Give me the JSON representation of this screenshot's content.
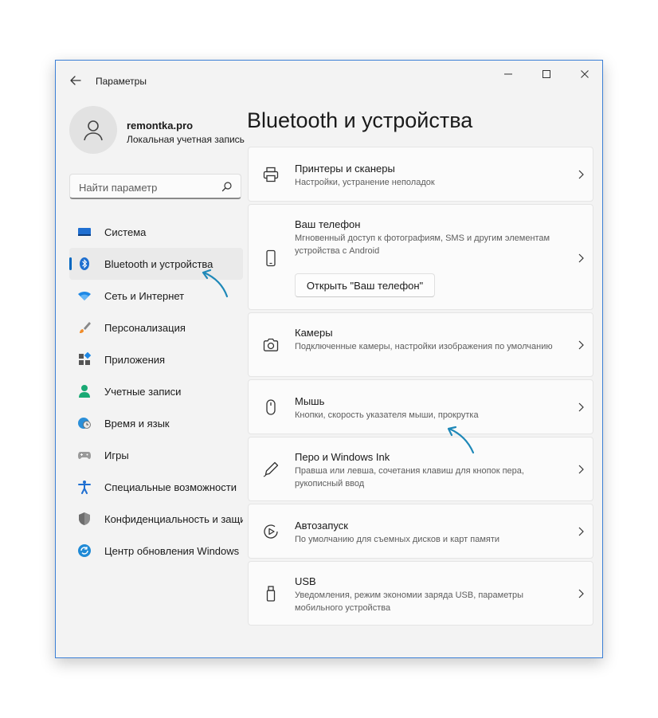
{
  "window": {
    "title": "Параметры"
  },
  "user": {
    "name": "remontka.pro",
    "account_type": "Локальная учетная запись"
  },
  "search": {
    "placeholder": "Найти параметр"
  },
  "sidebar": {
    "items": [
      {
        "label": "Система",
        "icon": "monitor-icon"
      },
      {
        "label": "Bluetooth и устройства",
        "icon": "bluetooth-icon",
        "active": true
      },
      {
        "label": "Сеть и Интернет",
        "icon": "wifi-icon"
      },
      {
        "label": "Персонализация",
        "icon": "brush-icon"
      },
      {
        "label": "Приложения",
        "icon": "apps-icon"
      },
      {
        "label": "Учетные записи",
        "icon": "person-icon"
      },
      {
        "label": "Время и язык",
        "icon": "globe-clock-icon"
      },
      {
        "label": "Игры",
        "icon": "gamepad-icon"
      },
      {
        "label": "Специальные возможности",
        "icon": "accessibility-icon"
      },
      {
        "label": "Конфиденциальность и защита",
        "icon": "shield-icon"
      },
      {
        "label": "Центр обновления Windows",
        "icon": "update-icon"
      }
    ]
  },
  "main": {
    "title": "Bluetooth и устройства",
    "cards": [
      {
        "title": "Принтеры и сканеры",
        "desc": "Настройки, устранение неполадок",
        "icon": "printer-icon"
      },
      {
        "title": "Ваш телефон",
        "desc": "Мгновенный доступ к фотографиям, SMS и другим элементам устройства с Android",
        "icon": "phone-icon",
        "button": "Открыть \"Ваш телефон\""
      },
      {
        "title": "Камеры",
        "desc": "Подключенные камеры, настройки изображения по умолчанию",
        "icon": "camera-icon"
      },
      {
        "title": "Мышь",
        "desc": "Кнопки, скорость указателя мыши, прокрутка",
        "icon": "mouse-icon"
      },
      {
        "title": "Перо и Windows Ink",
        "desc": "Правша или левша, сочетания клавиш для кнопок пера, рукописный ввод",
        "icon": "pen-icon"
      },
      {
        "title": "Автозапуск",
        "desc": "По умолчанию для съемных дисков и карт памяти",
        "icon": "autoplay-icon"
      },
      {
        "title": "USB",
        "desc": "Уведомления, режим экономии заряда USB, параметры мобильного устройства",
        "icon": "usb-icon"
      }
    ]
  },
  "colors": {
    "accent": "#0067c0",
    "annotation_arrow": "#1e88b8",
    "window_border": "#3b7fd6"
  }
}
